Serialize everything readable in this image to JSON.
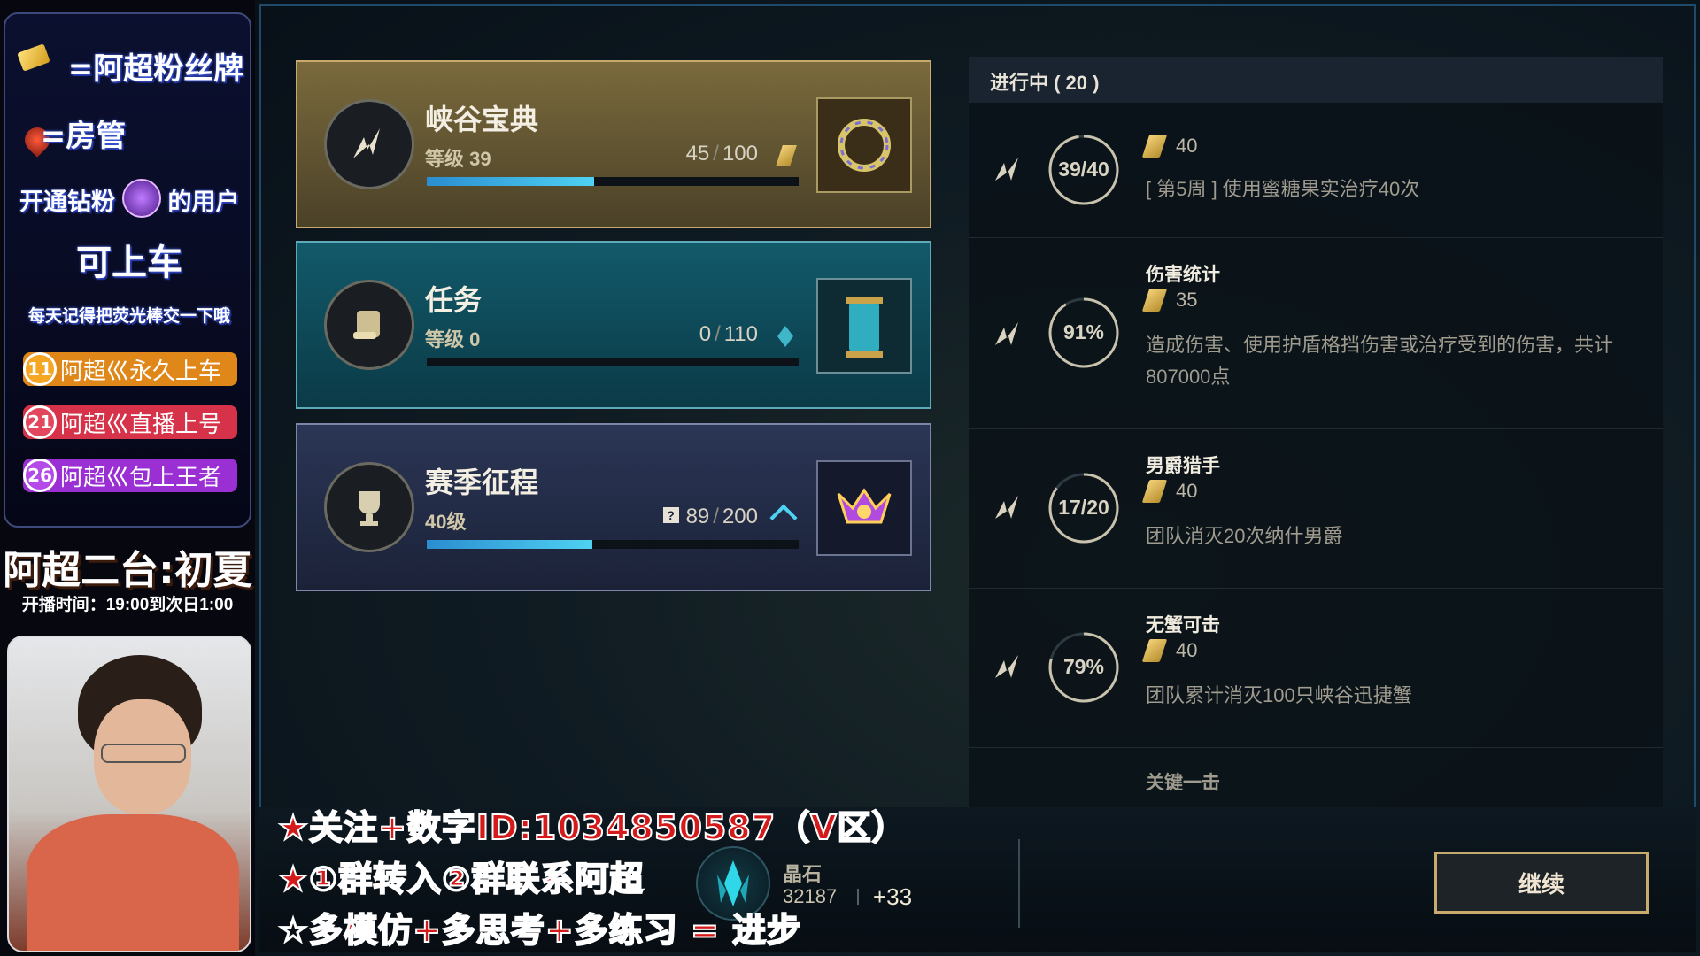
{
  "sidebar": {
    "promo_lines": [
      "=阿超粉丝牌",
      "=房管",
      "开通钻粉",
      "的用户",
      "可上车",
      "每天记得把荧光棒交一下哦"
    ],
    "badges": [
      {
        "level": "11",
        "text": "阿超巛永久上车",
        "color": "#e0871a"
      },
      {
        "level": "21",
        "text": "阿超巛直播上号",
        "color": "#d6334a"
      },
      {
        "level": "26",
        "text": "阿超巛包上王者",
        "color": "#9a2fd4"
      }
    ],
    "streamer_title": "阿超二台:初夏",
    "stream_time": "开播时间：19:00到次日1:00"
  },
  "passes": [
    {
      "title": "峡谷宝典",
      "level": "等级 39",
      "progress": "45",
      "total": "100",
      "fill": 0.45
    },
    {
      "title": "任务",
      "level": "等级 0",
      "progress": "0",
      "total": "110",
      "fill": 0.0
    },
    {
      "title": "赛季征程",
      "level": "40级",
      "progress": "89",
      "total": "200",
      "fill": 0.445
    }
  ],
  "missions_header": "进行中 ( 20 )",
  "missions": [
    {
      "ring": "39/40",
      "fill": 0.975,
      "name": "",
      "xp": "40",
      "desc": "[ 第5周 ] 使用蜜糖果实治疗40次"
    },
    {
      "ring": "91%",
      "fill": 0.91,
      "name": "伤害统计",
      "xp": "35",
      "desc": "造成伤害、使用护盾格挡伤害或治疗受到的伤害，共计807000点"
    },
    {
      "ring": "17/20",
      "fill": 0.85,
      "name": "男爵猎手",
      "xp": "40",
      "desc": "团队消灭20次纳什男爵"
    },
    {
      "ring": "79%",
      "fill": 0.79,
      "name": "无蟹可击",
      "xp": "40",
      "desc": "团队累计消灭100只峡谷迅捷蟹"
    },
    {
      "ring": "",
      "fill": 0.0,
      "name": "关键一击",
      "xp": "",
      "desc": ""
    }
  ],
  "overlay": {
    "line1": "★关注+数字ID:1034850587（V区）",
    "line2": "★①群转入②群联系阿超",
    "line3": "☆多模仿+多思考+多练习 = 进步"
  },
  "currency": {
    "label": "晶石",
    "value": "32187",
    "delta": "+33"
  },
  "continue_label": "继续",
  "colors": {
    "gold": "#c8aa6e",
    "teal": "#0e5c6e",
    "accent_blue": "#4fd2f2"
  }
}
